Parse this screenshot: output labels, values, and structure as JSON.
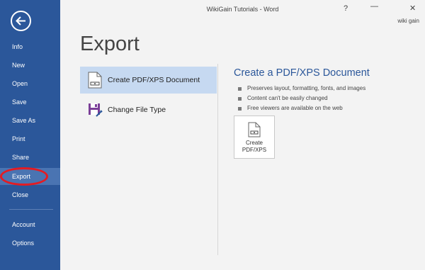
{
  "window": {
    "title": "WikiGain Tutorials - Word",
    "help": "?",
    "minimize": "—",
    "close": "✕",
    "user": "wiki gain"
  },
  "sidebar": {
    "back_icon": "back-arrow-icon",
    "items": [
      {
        "label": "Info"
      },
      {
        "label": "New"
      },
      {
        "label": "Open"
      },
      {
        "label": "Save"
      },
      {
        "label": "Save As"
      },
      {
        "label": "Print"
      },
      {
        "label": "Share"
      },
      {
        "label": "Export",
        "active": true
      },
      {
        "label": "Close"
      },
      {
        "label": "Account"
      },
      {
        "label": "Options"
      }
    ]
  },
  "page": {
    "title": "Export",
    "options": [
      {
        "label": "Create PDF/XPS Document",
        "icon": "pdf-document-icon",
        "selected": true
      },
      {
        "label": "Change File Type",
        "icon": "change-file-type-icon",
        "selected": false
      }
    ],
    "detail": {
      "title": "Create a PDF/XPS Document",
      "bullets": [
        "Preserves layout, formatting, fonts, and images",
        "Content can't be easily changed",
        "Free viewers are available on the web"
      ],
      "button": {
        "line1": "Create",
        "line2": "PDF/XPS",
        "icon": "pdf-document-icon"
      }
    }
  },
  "colors": {
    "sidebar": "#2b579a",
    "active_item": "#4a74b2",
    "selected_option": "#c6d9f1",
    "accent_text": "#2b579a",
    "annotation_ring": "#e31c23"
  }
}
